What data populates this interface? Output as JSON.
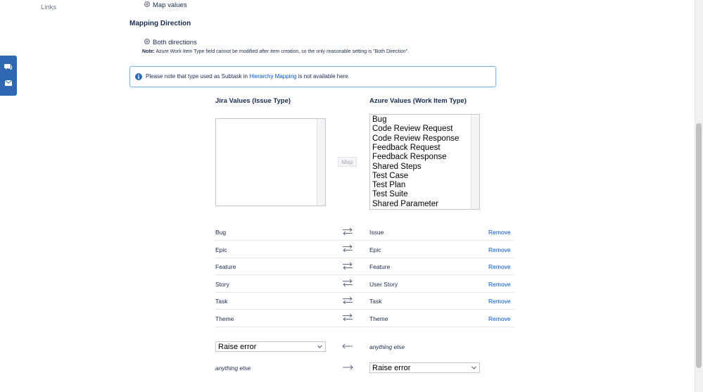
{
  "sidebar": {
    "links_label": "Links"
  },
  "radio_map_values": {
    "label": "Map values"
  },
  "mapping_direction": {
    "title": "Mapping Direction",
    "option_label": "Both directions",
    "note_prefix": "Note:",
    "note_text": "Azure Work Item Type field cannot be modified after item creation, so the only reasonable setting is \"Both Direction\"."
  },
  "floating_widget": {
    "icons": [
      "chat-icon",
      "envelope-icon"
    ]
  },
  "info": {
    "text_before": "Please note that type used as Subtask in",
    "link_text": "Hierarchy Mapping",
    "text_after": "is not available here."
  },
  "jira_column": {
    "title": "Jira Values (Issue Type)",
    "options": []
  },
  "azure_column": {
    "title": "Azure Values (Work Item Type)",
    "options": [
      "Bug",
      "Code Review Request",
      "Code Review Response",
      "Feedback Request",
      "Feedback Response",
      "Shared Steps",
      "Test Case",
      "Test Plan",
      "Test Suite",
      "Shared Parameter"
    ]
  },
  "map_button": {
    "label": "Map"
  },
  "mappings": [
    {
      "jira": "Bug",
      "azure": "Issue",
      "action": "Remove"
    },
    {
      "jira": "Epic",
      "azure": "Epic",
      "action": "Remove"
    },
    {
      "jira": "Feature",
      "azure": "Feature",
      "action": "Remove"
    },
    {
      "jira": "Story",
      "azure": "User Story",
      "action": "Remove"
    },
    {
      "jira": "Task",
      "azure": "Task",
      "action": "Remove"
    },
    {
      "jira": "Theme",
      "azure": "Theme",
      "action": "Remove"
    }
  ],
  "fallback": {
    "jira_select_value": "Raise error",
    "azure_label": "anything else",
    "jira_label": "anything else",
    "azure_select_value": "Raise error"
  },
  "colors": {
    "accent": "#0052cc",
    "widget": "#2f69b3",
    "info_border": "#7fb3e8"
  }
}
